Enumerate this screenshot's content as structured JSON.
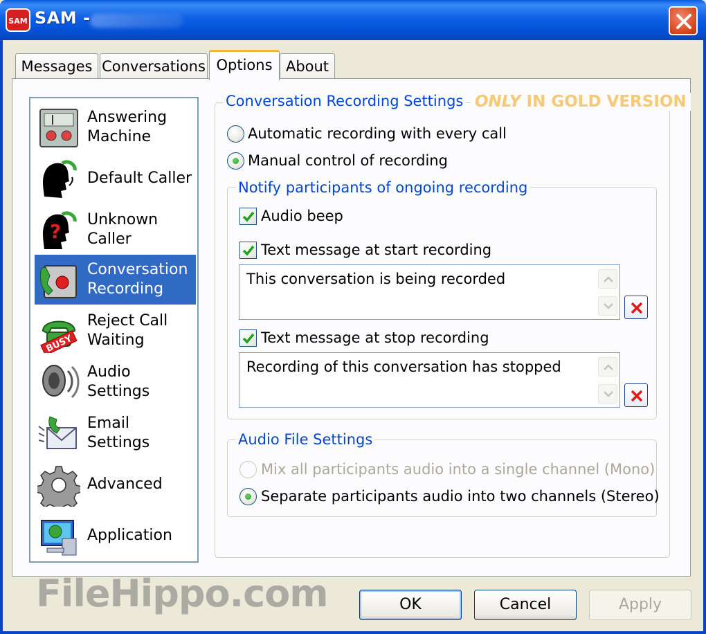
{
  "window": {
    "title": "SAM -",
    "app_icon_text": "SAM",
    "close_icon": "close-icon"
  },
  "tabs": [
    {
      "label": "Messages"
    },
    {
      "label": "Conversations"
    },
    {
      "label": "Options",
      "active": true
    },
    {
      "label": "About"
    }
  ],
  "sidebar": {
    "items": [
      {
        "label1": "Answering",
        "label2": "Machine",
        "icon": "answering-machine-icon"
      },
      {
        "label1": "Default Caller",
        "label2": "",
        "icon": "default-caller-icon"
      },
      {
        "label1": "Unknown",
        "label2": "Caller",
        "icon": "unknown-caller-icon"
      },
      {
        "label1": "Conversation",
        "label2": "Recording",
        "icon": "conversation-recording-icon",
        "selected": true
      },
      {
        "label1": "Reject Call",
        "label2": "Waiting",
        "icon": "reject-call-icon",
        "badge": "BUSY"
      },
      {
        "label1": "Audio",
        "label2": "Settings",
        "icon": "speaker-icon"
      },
      {
        "label1": "Email",
        "label2": "Settings",
        "icon": "email-icon"
      },
      {
        "label1": "Advanced",
        "label2": "",
        "icon": "gear-icon"
      },
      {
        "label1": "Application",
        "label2": "",
        "icon": "application-icon"
      }
    ]
  },
  "recording": {
    "legend": "Conversation Recording Settings",
    "gold_only": "ONLY",
    "gold_rest": " IN GOLD VERSION",
    "auto_label": "Automatic recording with every call",
    "manual_label": "Manual control of recording",
    "selected": "manual"
  },
  "notify": {
    "legend": "Notify participants of ongoing recording",
    "audio_beep": "Audio beep",
    "start_label": "Text message at start recording",
    "start_text": "This conversation is being recorded",
    "stop_label": "Text message at stop recording",
    "stop_text": "Recording of this conversation has stopped"
  },
  "audio_file": {
    "legend": "Audio File Settings",
    "mono_label": "Mix all participants audio into a single channel (Mono)",
    "stereo_label": "Separate participants audio into two channels (Stereo)",
    "selected": "stereo"
  },
  "buttons": {
    "ok": "OK",
    "cancel": "Cancel",
    "apply": "Apply"
  },
  "watermark": "FileHippo.com",
  "colors": {
    "title_bar": "#0a5de0",
    "selected_item": "#316ac5",
    "legend_text": "#0046d5",
    "gold_text": "#f8c875",
    "close_button": "#d6461c"
  }
}
